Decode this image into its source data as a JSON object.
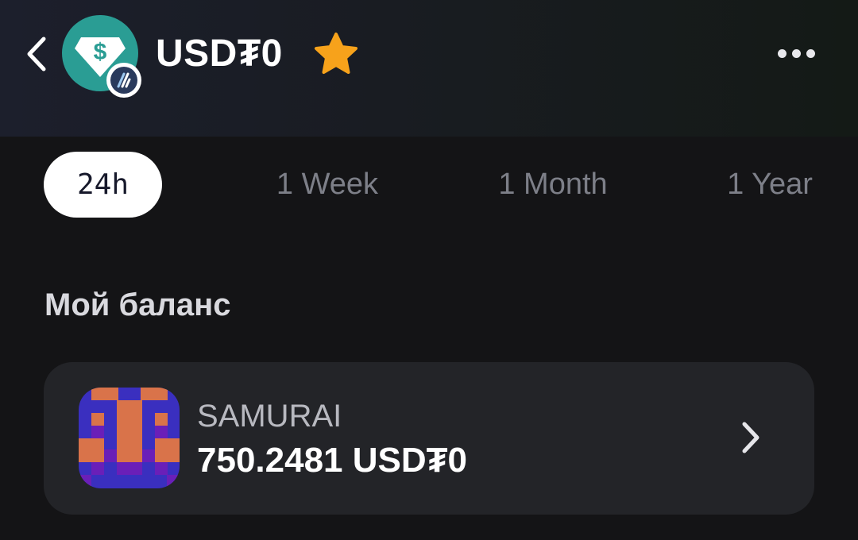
{
  "header": {
    "title": "USD₮0",
    "icons": {
      "back": "chevron-left-icon",
      "token": "usdt0-token-icon",
      "chain": "arbitrum-chain-badge",
      "favorite": "star-icon",
      "more": "more-horizontal-icon"
    },
    "colors": {
      "token_bg": "#2a9d94",
      "star": "#f7a21b"
    }
  },
  "tabs": [
    {
      "label": "24h",
      "active": true
    },
    {
      "label": "1 Week",
      "active": false
    },
    {
      "label": "1 Month",
      "active": false
    },
    {
      "label": "1 Year",
      "active": false
    }
  ],
  "balance": {
    "section_title": "Мой баланс",
    "items": [
      {
        "name": "SAMURAI",
        "amount": "750.2481 USD₮0",
        "avatar_icon": "samurai-pixel-avatar",
        "chevron_icon": "chevron-right-icon"
      }
    ]
  }
}
